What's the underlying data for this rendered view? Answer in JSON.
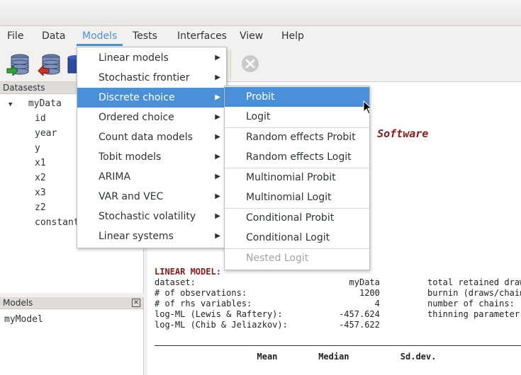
{
  "menubar": {
    "items": [
      "File",
      "Data",
      "Models",
      "Tests",
      "Interfaces",
      "View",
      "Help"
    ]
  },
  "datasets_panel": {
    "title": "Datasests",
    "dataset": "myData",
    "vars": [
      "id",
      "year",
      "y",
      "x1",
      "x2",
      "x3",
      "z2",
      "constant"
    ]
  },
  "models_panel": {
    "title": "Models",
    "close_glyph": "✕",
    "items": [
      "myModel"
    ]
  },
  "models_menu": {
    "items": [
      "Linear models",
      "Stochastic frontier",
      "Discrete choice",
      "Ordered choice",
      "Count data models",
      "Tobit models",
      "ARIMA",
      "VAR and VEC",
      "Stochastic volatility",
      "Linear systems"
    ],
    "submenu_arrow": "▶"
  },
  "discrete_submenu": {
    "items": [
      "Probit",
      "Logit",
      "Random effects Probit",
      "Random effects Logit",
      "Multinomial Probit",
      "Multinomial Logit",
      "Conditional Probit",
      "Conditional Logit",
      "Nested Logit"
    ]
  },
  "output": {
    "banner_fragment": "cs Software",
    "section_title": "LINEAR MODEL:",
    "left_lines": [
      "dataset:                              myData",
      "# of observations:                      1200",
      "# of rhs variables:                        4",
      "",
      "log-ML (Lewis & Raftery):           -457.624",
      "log-ML (Chib & Jeliazkov):          -457.622"
    ],
    "right_lines": [
      "total retained draw",
      "burnin (draws/chain",
      "number of chains:",
      "thinning parameter:"
    ],
    "table_header": "                    Mean        Median          Sd.dev."
  },
  "colors": {
    "accent": "#4a90d9",
    "banner": "#8b1a1a"
  }
}
